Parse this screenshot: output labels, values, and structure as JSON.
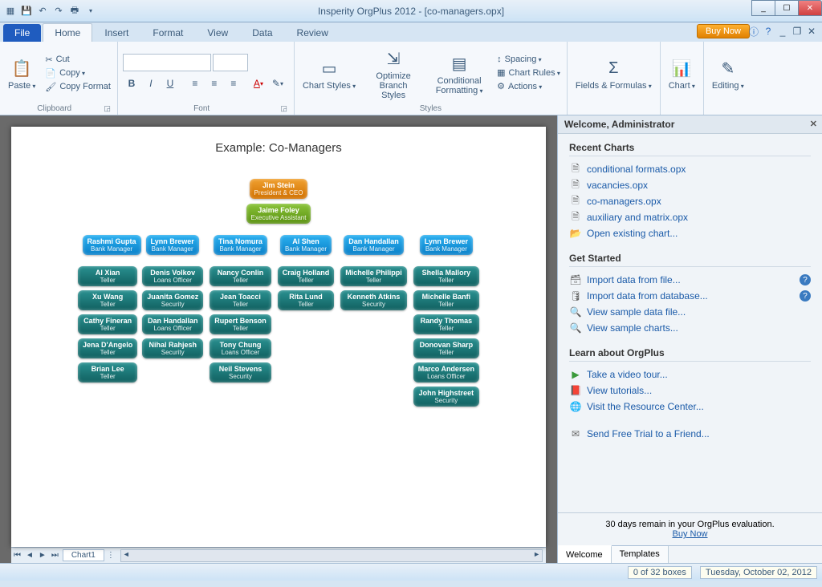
{
  "title": "Insperity OrgPlus 2012 - [co-managers.opx]",
  "qat": [
    "app-icon",
    "save",
    "undo",
    "redo",
    "print"
  ],
  "tabs": {
    "file": "File",
    "items": [
      "Home",
      "Insert",
      "Format",
      "View",
      "Data",
      "Review"
    ],
    "active": 0
  },
  "buy_now": "Buy Now",
  "ribbon": {
    "clipboard": {
      "label": "Clipboard",
      "paste": "Paste",
      "cut": "Cut",
      "copy": "Copy",
      "copy_format": "Copy Format"
    },
    "font": {
      "label": "Font"
    },
    "styles": {
      "label": "Styles",
      "chart_styles": "Chart Styles",
      "optimize": "Optimize Branch Styles",
      "conditional": "Conditional Formatting",
      "spacing": "Spacing",
      "chart_rules": "Chart Rules",
      "actions": "Actions"
    },
    "fields": {
      "label": "Fields & Formulas"
    },
    "chart": {
      "label": "Chart"
    },
    "editing": {
      "label": "Editing"
    }
  },
  "chart_title": "Example: Co-Managers",
  "org": {
    "ceo": {
      "name": "Jim Stein",
      "title": "President & CEO"
    },
    "ea": {
      "name": "Jaime Foley",
      "title": "Executive Assistant"
    },
    "managers": [
      {
        "twin": [
          {
            "name": "Rashmi Gupta",
            "title": "Bank Manager"
          },
          {
            "name": "Lynn Brewer",
            "title": "Bank Manager"
          }
        ],
        "cols": [
          [
            {
              "name": "Al Xian",
              "title": "Teller"
            },
            {
              "name": "Xu Wang",
              "title": "Teller"
            },
            {
              "name": "Cathy Fineran",
              "title": "Teller"
            },
            {
              "name": "Jena D'Angelo",
              "title": "Teller"
            },
            {
              "name": "Brian Lee",
              "title": "Teller"
            }
          ],
          [
            {
              "name": "Denis Volkov",
              "title": "Loans Officer"
            },
            {
              "name": "Juanita Gomez",
              "title": "Security"
            },
            {
              "name": "Dan Handallan",
              "title": "Loans Officer"
            },
            {
              "name": "Nihal Rahjesh",
              "title": "Security"
            }
          ]
        ]
      },
      {
        "mgr": {
          "name": "Tina Nomura",
          "title": "Bank Manager"
        },
        "emps": [
          {
            "name": "Nancy Conlin",
            "title": "Teller"
          },
          {
            "name": "Jean Toacci",
            "title": "Teller"
          },
          {
            "name": "Rupert Benson",
            "title": "Teller"
          },
          {
            "name": "Tony Chung",
            "title": "Loans Officer"
          },
          {
            "name": "Neil Stevens",
            "title": "Security"
          }
        ]
      },
      {
        "mgr": {
          "name": "Al Shen",
          "title": "Bank Manager"
        },
        "emps": [
          {
            "name": "Craig Holland",
            "title": "Teller"
          },
          {
            "name": "Rita Lund",
            "title": "Teller"
          }
        ]
      },
      {
        "mgr": {
          "name": "Dan Handallan",
          "title": "Bank Manager"
        },
        "emps": [
          {
            "name": "Michelle Philippi",
            "title": "Teller"
          },
          {
            "name": "Kenneth Atkins",
            "title": "Security"
          }
        ]
      },
      {
        "mgr": {
          "name": "Lynn Brewer",
          "title": "Bank Manager"
        },
        "emps": [
          {
            "name": "Shella Mallory",
            "title": "Teller"
          },
          {
            "name": "Michelle Banfi",
            "title": "Teller"
          },
          {
            "name": "Randy Thomas",
            "title": "Teller"
          },
          {
            "name": "Donovan Sharp",
            "title": "Teller"
          },
          {
            "name": "Marco Andersen",
            "title": "Loans Officer"
          },
          {
            "name": "John Highstreet",
            "title": "Security"
          }
        ]
      }
    ]
  },
  "sheet": {
    "tab": "Chart1"
  },
  "panel": {
    "welcome": "Welcome, Administrator",
    "recent": {
      "h": "Recent Charts",
      "items": [
        "conditional formats.opx",
        "vacancies.opx",
        "co-managers.opx",
        "auxiliary and matrix.opx"
      ],
      "open": "Open existing chart..."
    },
    "started": {
      "h": "Get Started",
      "import_file": "Import data from file...",
      "import_db": "Import data from database...",
      "sample_file": "View sample data file...",
      "sample_charts": "View sample charts..."
    },
    "learn": {
      "h": "Learn about OrgPlus",
      "tour": "Take a video tour...",
      "tutorials": "View tutorials...",
      "resource": "Visit the Resource Center..."
    },
    "send": "Send Free Trial to a Friend...",
    "trial": "30 days remain in your OrgPlus evaluation.",
    "trial_buy": "Buy Now",
    "tabs": [
      "Welcome",
      "Templates"
    ]
  },
  "status": {
    "boxes": "0 of 32 boxes",
    "date": "Tuesday, October 02, 2012"
  },
  "chart_data": {
    "type": "org-chart",
    "hierarchy": "See org key: CEO → EA + 5 manager branches (first branch has co-managers Rashmi Gupta & Lynn Brewer sharing two employee columns)"
  }
}
